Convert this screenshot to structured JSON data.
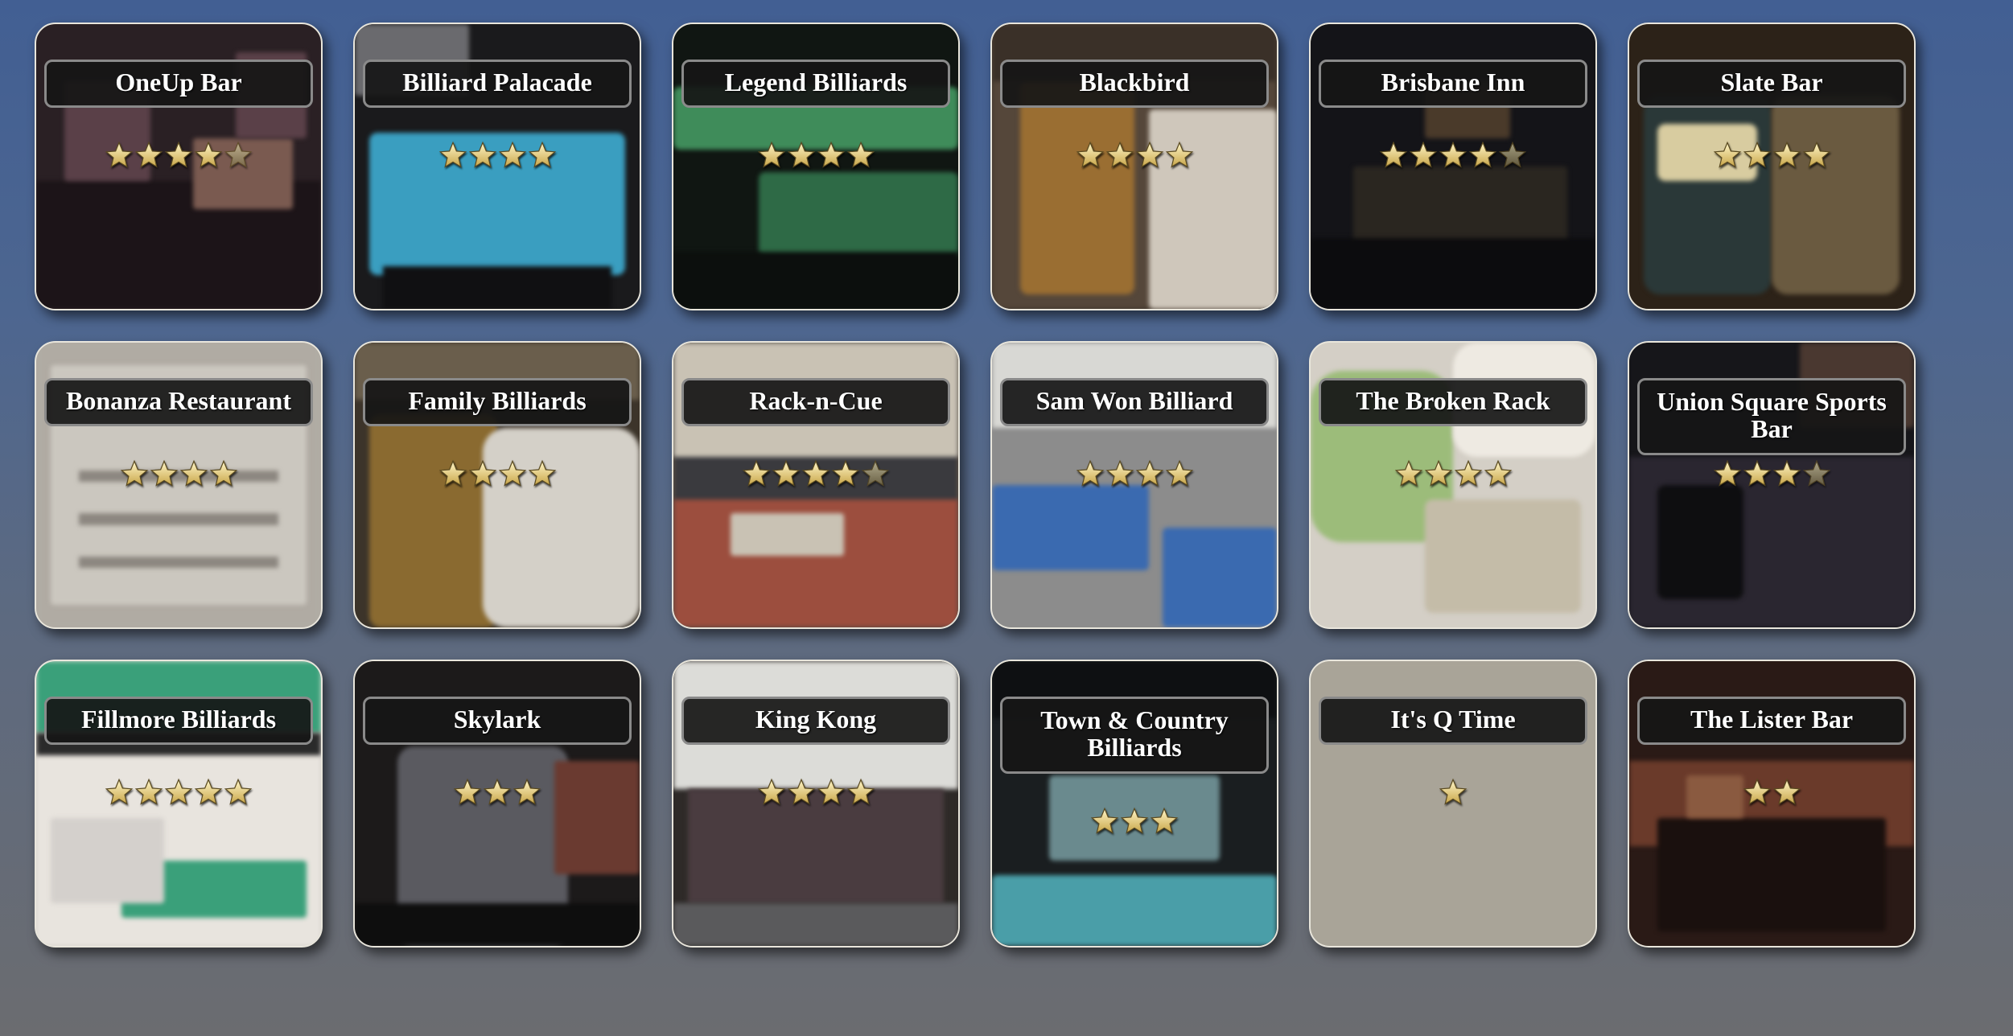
{
  "venues": [
    {
      "name": "OneUp Bar",
      "rating": 4.5,
      "colors": {
        "bg": "#2a2024",
        "a": "#5a4048",
        "b": "#1c1418",
        "c": "#7a5a50"
      }
    },
    {
      "name": "Billiard Palacade",
      "rating": 4,
      "colors": {
        "bg": "#1a1a1c",
        "a": "#3a9ec0",
        "b": "#101012",
        "c": "#6a6a6e"
      }
    },
    {
      "name": "Legend Billiards",
      "rating": 4,
      "colors": {
        "bg": "#101612",
        "a": "#3f8c5a",
        "b": "#0c0f0d",
        "c": "#2e6a46"
      }
    },
    {
      "name": "Blackbird",
      "rating": 4,
      "colors": {
        "bg": "#3a3028",
        "a": "#9a6e32",
        "b": "#cfc7bb",
        "c": "#55473a"
      }
    },
    {
      "name": "Brisbane Inn",
      "rating": 4.5,
      "colors": {
        "bg": "#141418",
        "a": "#2a2620",
        "b": "#0c0c0e",
        "c": "#4a3a2a"
      }
    },
    {
      "name": "Slate Bar",
      "rating": 4,
      "colors": {
        "bg": "#2c2218",
        "a": "#d8cca0",
        "b": "#2a3838",
        "c": "#6a5a40"
      }
    },
    {
      "name": "Bonanza Restaurant",
      "rating": 4,
      "colors": {
        "bg": "#b0aba3",
        "a": "#cbc7bf",
        "b": "#8c8780",
        "c": "#9c978f"
      }
    },
    {
      "name": "Family Billiards",
      "rating": 4,
      "colors": {
        "bg": "#3c342a",
        "a": "#8a6a30",
        "b": "#d4d0c8",
        "c": "#6a5e4c"
      }
    },
    {
      "name": "Rack-n-Cue",
      "rating": 4.5,
      "colors": {
        "bg": "#6c5a4a",
        "a": "#9c4e3e",
        "b": "#c9c2b4",
        "c": "#3a3a3e"
      }
    },
    {
      "name": "Sam Won Billiard",
      "rating": 4,
      "colors": {
        "bg": "#8c8c8c",
        "a": "#3a6ab0",
        "b": "#d8d8d4",
        "c": "#5a5a5c"
      }
    },
    {
      "name": "The Broken Rack",
      "rating": 4,
      "colors": {
        "bg": "#d4cfc6",
        "a": "#9cbc7a",
        "b": "#c4bca8",
        "c": "#eeeae2"
      }
    },
    {
      "name": "Union Square Sports Bar",
      "rating": 3.5,
      "colors": {
        "bg": "#16161a",
        "a": "#2a2630",
        "b": "#0e0e10",
        "c": "#4a3830"
      }
    },
    {
      "name": "Fillmore Billiards",
      "rating": 5,
      "colors": {
        "bg": "#d4d0cc",
        "a": "#3aa07a",
        "b": "#2a2a2a",
        "c": "#e8e4de"
      }
    },
    {
      "name": "Skylark",
      "rating": 3,
      "colors": {
        "bg": "#1c1a1a",
        "a": "#5a5a60",
        "b": "#0e0e0e",
        "c": "#6a3a30"
      }
    },
    {
      "name": "King Kong",
      "rating": 4,
      "colors": {
        "bg": "#2e2a28",
        "a": "#dcdcd8",
        "b": "#4a3c40",
        "c": "#5a5a5c"
      }
    },
    {
      "name": "Town & Country Billiards",
      "rating": 3,
      "colors": {
        "bg": "#1a1e20",
        "a": "#4a9ea8",
        "b": "#0e1012",
        "c": "#6a8a8e"
      }
    },
    {
      "name": "It's Q Time",
      "rating": 1,
      "colors": {
        "bg": "#a9a498",
        "a": "#a9a498",
        "b": "#a9a498",
        "c": "#a9a498"
      }
    },
    {
      "name": "The Lister Bar",
      "rating": 2,
      "colors": {
        "bg": "#2a1a16",
        "a": "#6a3a2a",
        "b": "#1a100e",
        "c": "#8a5a40"
      }
    }
  ],
  "icons": {
    "star": "star-icon"
  }
}
